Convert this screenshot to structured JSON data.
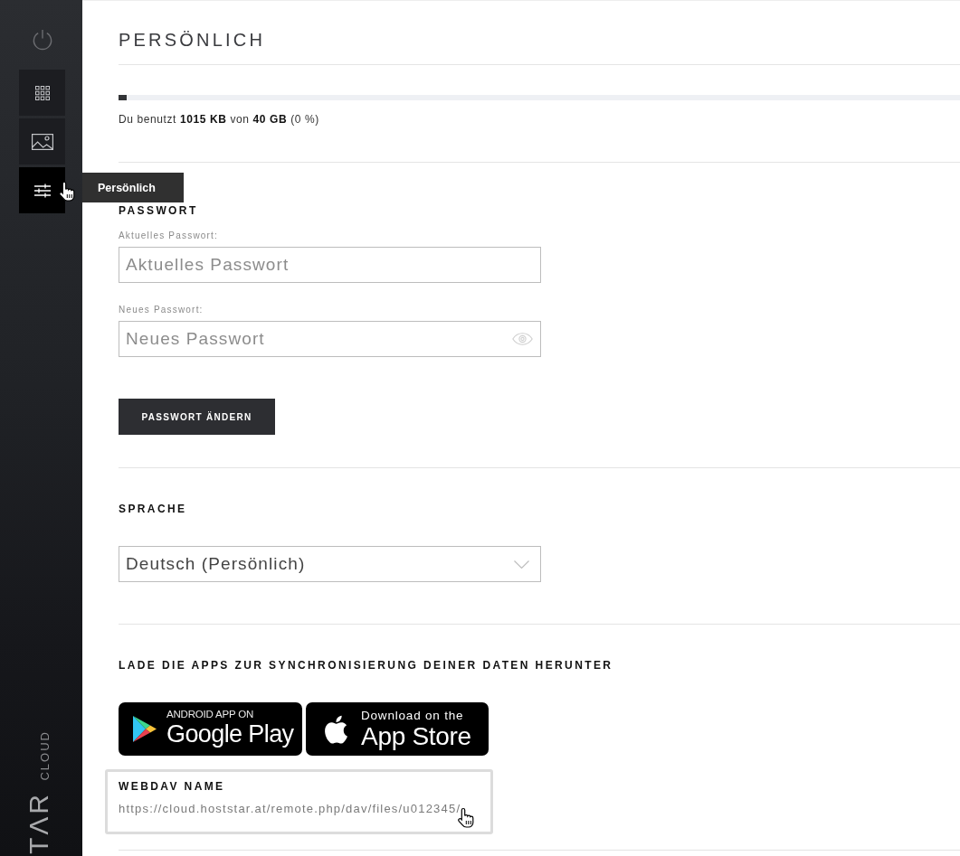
{
  "sidebar": {
    "items": [
      {
        "kind": "grid",
        "selected": false,
        "hovered": false
      },
      {
        "kind": "image",
        "selected": false,
        "hovered": false
      },
      {
        "kind": "sliders",
        "selected": true,
        "hovered": true,
        "tooltip": "Persönlich"
      }
    ],
    "brand": {
      "product": "CLOUD",
      "logo": "TΛR"
    }
  },
  "page": {
    "title": "PERSÖNLICH"
  },
  "storage": {
    "level": 0.01,
    "text": "Du benutzt **1015 KB** von **40 GB** (0 %)"
  },
  "password": {
    "heading": "PASSWORT",
    "fields": [
      {
        "label": "Aktuelles Passwort:",
        "placeholder": "Aktuelles Passwort",
        "show_toggle": false
      },
      {
        "label": "Neues Passwort:",
        "placeholder": "Neues Passwort",
        "show_toggle": true
      }
    ],
    "button": "PASSWORT ÄNDERN"
  },
  "language": {
    "heading": "SPRACHE",
    "value": "Deutsch (Persönlich)"
  },
  "apps": {
    "heading": "LADE DIE APPS ZUR SYNCHRONISIERUNG DEINER DATEN HERUNTER",
    "badges": [
      {
        "kind": "google-play",
        "caption": "ANDROID APP ON",
        "store": "Google Play"
      },
      {
        "kind": "app-store",
        "caption": "Download on the",
        "store": "App Store"
      }
    ]
  },
  "webdav": {
    "heading": "WEBDAV NAME",
    "url": "https://cloud.hoststar.at/remote.php/dav/files/u012345/",
    "hovered": true
  }
}
